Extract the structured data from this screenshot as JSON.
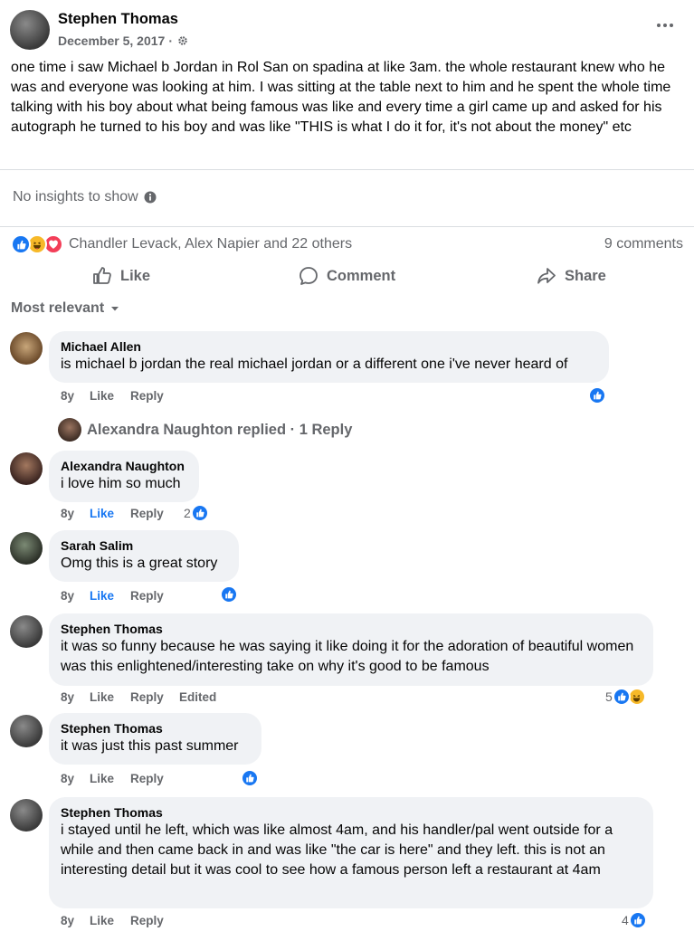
{
  "post": {
    "author": "Stephen Thomas",
    "date": "December 5, 2017",
    "separator": "·",
    "text": "one time i saw Michael b Jordan in Rol San on spadina at like 3am. the whole restaurant knew who he was and everyone was looking at him. I was sitting at the table next to him and he spent the whole time talking with his boy about what being famous was like and every time a girl came up and asked for his autograph he turned to his boy and was like \"THIS is what I do it for, it's not about the money\" etc"
  },
  "insights": {
    "text": "No insights to show"
  },
  "reactions": {
    "names": "Chandler Levack, Alex Napier and 22 others",
    "comment_count": "9 comments"
  },
  "actions": {
    "like": "Like",
    "comment": "Comment",
    "share": "Share"
  },
  "sort": {
    "label": "Most relevant"
  },
  "comments": [
    {
      "name": "Michael Allen",
      "text": "is michael b jordan the real michael jordan or a different one i've never heard of",
      "time": "8y",
      "like": "Like",
      "reply": "Reply"
    },
    {
      "name": "Alexandra Naughton",
      "text": "i love him so much",
      "time": "8y",
      "like": "Like",
      "reply": "Reply",
      "reaction_count": "2"
    },
    {
      "name": "Sarah Salim",
      "text": "Omg this is a great story",
      "time": "8y",
      "like": "Like",
      "reply": "Reply"
    },
    {
      "name": "Stephen Thomas",
      "text": "it was so funny because he was saying it like doing it for the adoration of beautiful women was this enlightened/interesting take on why it's good to be famous",
      "time": "8y",
      "like": "Like",
      "reply": "Reply",
      "edited": "Edited",
      "reaction_count": "5"
    },
    {
      "name": "Stephen Thomas",
      "text": "it was just this past summer",
      "time": "8y",
      "like": "Like",
      "reply": "Reply"
    },
    {
      "name": "Stephen Thomas",
      "text": "i stayed until he left, which was like almost 4am, and his handler/pal went outside for a while and then came back in and was like \"the car is here\" and they left. this is not an interesting detail but it was cool to see how a famous person left a restaurant at 4am",
      "time": "8y",
      "like": "Like",
      "reply": "Reply",
      "reaction_count": "4"
    }
  ],
  "reply_thread": {
    "text": "Alexandra Naughton replied · 1 Reply"
  },
  "colors": {
    "accent": "#1877f2",
    "secondary_text": "#65676b",
    "bubble": "#f0f2f5"
  }
}
